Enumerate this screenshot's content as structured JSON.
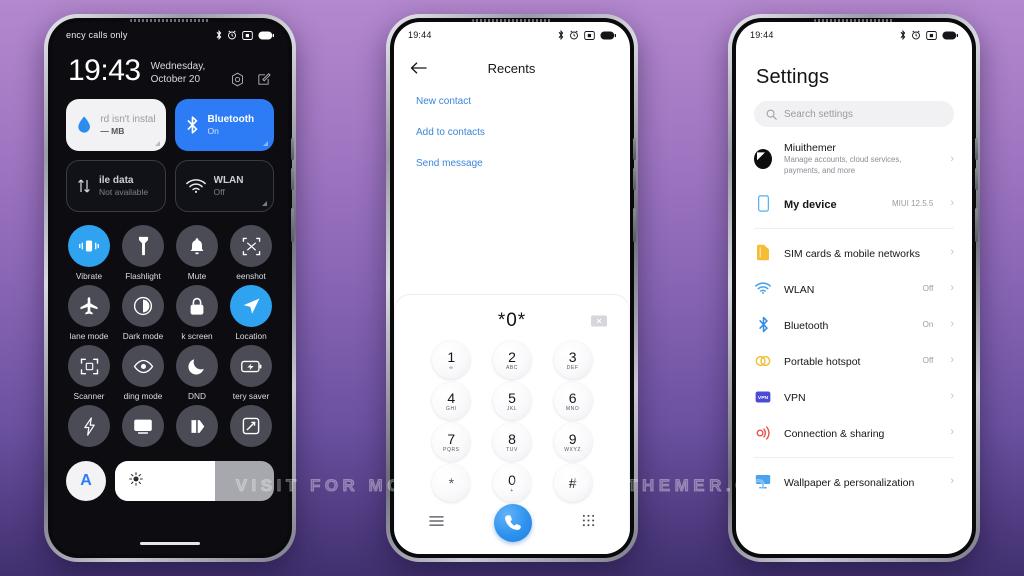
{
  "background": {
    "top_color": "#b388ce",
    "bottom_color": "#40306f"
  },
  "watermark": {
    "text": "VISIT FOR MORE THEMES - MIUITHEMER.COM"
  },
  "phone1": {
    "status": {
      "carrier": "ency calls only",
      "icons": [
        "bluetooth-icon",
        "alarm-icon",
        "screenshot-icon",
        "battery-icon"
      ]
    },
    "clock": {
      "time": "19:43",
      "date": "Wednesday, October 20"
    },
    "big_tiles": [
      {
        "title": "rd isn't install",
        "value": "— MB",
        "state": "off",
        "icon": "data-drop-icon",
        "style": "white"
      },
      {
        "title": "Bluetooth",
        "value": "On",
        "state": "on",
        "icon": "bluetooth-icon",
        "style": "blue"
      },
      {
        "title": "ile data",
        "value": "Not available",
        "state": "off",
        "icon": "mobile-data-icon",
        "style": "dark"
      },
      {
        "title": "WLAN",
        "value": "Off",
        "state": "off",
        "icon": "wifi-icon",
        "style": "dark"
      }
    ],
    "tiles": [
      {
        "label": "Vibrate",
        "icon": "vibrate-icon",
        "on": true
      },
      {
        "label": "Flashlight",
        "icon": "flashlight-icon",
        "on": false
      },
      {
        "label": "Mute",
        "icon": "bell-icon",
        "on": false
      },
      {
        "label": "eenshot",
        "icon": "screenshot-icon",
        "on": false
      },
      {
        "label": "lane mode",
        "icon": "airplane-icon",
        "on": false
      },
      {
        "label": "Dark mode",
        "icon": "contrast-icon",
        "on": false
      },
      {
        "label": "k screen",
        "icon": "lock-icon",
        "on": false
      },
      {
        "label": "Location",
        "icon": "location-icon",
        "on": true
      },
      {
        "label": "Scanner",
        "icon": "scan-frame-icon",
        "on": false
      },
      {
        "label": "ding mode",
        "icon": "eye-icon",
        "on": false
      },
      {
        "label": "DND",
        "icon": "moon-icon",
        "on": false
      },
      {
        "label": "tery saver",
        "icon": "battery-saver-icon",
        "on": false
      },
      {
        "label": "",
        "icon": "lightning-icon",
        "on": false
      },
      {
        "label": "",
        "icon": "cast-icon",
        "on": false
      },
      {
        "label": "",
        "icon": "reading-icon",
        "on": false
      },
      {
        "label": "",
        "icon": "rotate-icon",
        "on": false
      }
    ],
    "brightness": {
      "auto_label": "A",
      "icon": "sun-icon",
      "level_percent": 63
    }
  },
  "phone2": {
    "status": {
      "time": "19:44",
      "icons": [
        "bluetooth-icon",
        "alarm-icon",
        "screenshot-icon",
        "battery-icon"
      ]
    },
    "header": {
      "back_icon": "back-arrow-icon",
      "title": "Recents"
    },
    "links": [
      "New contact",
      "Add to contacts",
      "Send message"
    ],
    "dial": {
      "number": "*0*",
      "backspace_icon": "backspace-icon",
      "keys": [
        {
          "digit": "1",
          "letters": "∞"
        },
        {
          "digit": "2",
          "letters": "ABC"
        },
        {
          "digit": "3",
          "letters": "DEF"
        },
        {
          "digit": "4",
          "letters": "GHI"
        },
        {
          "digit": "5",
          "letters": "JKL"
        },
        {
          "digit": "6",
          "letters": "MNO"
        },
        {
          "digit": "7",
          "letters": "PQRS"
        },
        {
          "digit": "8",
          "letters": "TUV"
        },
        {
          "digit": "9",
          "letters": "WXYZ"
        },
        {
          "digit": "*",
          "letters": ""
        },
        {
          "digit": "0",
          "letters": "+"
        },
        {
          "digit": "#",
          "letters": ""
        }
      ]
    },
    "bottom_bar": {
      "menu_icon": "menu-icon",
      "call_icon": "phone-call-icon",
      "keypad_icon": "keypad-icon"
    }
  },
  "phone3": {
    "status": {
      "time": "19:44",
      "icons": [
        "bluetooth-icon",
        "alarm-icon",
        "screenshot-icon",
        "battery-icon"
      ]
    },
    "title": "Settings",
    "search": {
      "placeholder": "Search settings",
      "icon": "search-icon"
    },
    "account": {
      "name": "Miuithemer",
      "subtitle": "Manage accounts, cloud services, payments, and more",
      "icon": "avatar"
    },
    "device": {
      "label": "My device",
      "value": "MIUI 12.5.5",
      "icon": "phone-outline-icon"
    },
    "items": [
      {
        "label": "SIM cards & mobile networks",
        "value": "",
        "icon": "sim-card-icon",
        "color": "#f5bd35"
      },
      {
        "label": "WLAN",
        "value": "Off",
        "icon": "wifi-icon",
        "color": "#4aa3f0"
      },
      {
        "label": "Bluetooth",
        "value": "On",
        "icon": "bluetooth-icon",
        "color": "#2f8ae8"
      },
      {
        "label": "Portable hotspot",
        "value": "Off",
        "icon": "hotspot-icon",
        "color": "#f0c23c"
      },
      {
        "label": "VPN",
        "value": "",
        "icon": "vpn-icon",
        "color": "#4b4bd8"
      },
      {
        "label": "Connection & sharing",
        "value": "",
        "icon": "sharing-icon",
        "color": "#e4564a"
      }
    ],
    "items2": [
      {
        "label": "Wallpaper & personalization",
        "value": "",
        "icon": "wallpaper-icon",
        "color": "#4aa3f0"
      }
    ]
  }
}
